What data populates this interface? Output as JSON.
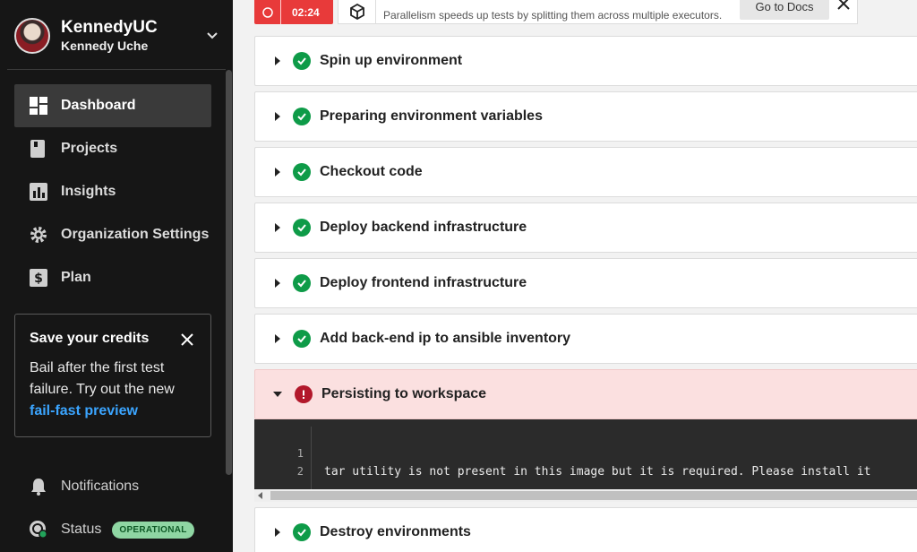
{
  "org": {
    "name": "KennedyUC",
    "user": "Kennedy Uche"
  },
  "nav": {
    "items": [
      {
        "label": "Dashboard",
        "icon": "dashboard-icon",
        "active": true
      },
      {
        "label": "Projects",
        "icon": "projects-icon",
        "active": false
      },
      {
        "label": "Insights",
        "icon": "insights-icon",
        "active": false
      },
      {
        "label": "Organization Settings",
        "icon": "gear-icon",
        "active": false
      },
      {
        "label": "Plan",
        "icon": "dollar-icon",
        "active": false
      }
    ]
  },
  "credits": {
    "title": "Save your credits",
    "body": "Bail after the first test failure. Try out the new",
    "link": "fail-fast preview"
  },
  "bottom": {
    "notifications": "Notifications",
    "status": "Status",
    "status_badge": "OPERATIONAL"
  },
  "job": {
    "timer": "02:24"
  },
  "tip": {
    "text": "Parallelism speeds up tests by splitting them across multiple executors.",
    "button": "Go to Docs"
  },
  "steps": [
    {
      "label": "Spin up environment",
      "status": "success"
    },
    {
      "label": "Preparing environment variables",
      "status": "success"
    },
    {
      "label": "Checkout code",
      "status": "success"
    },
    {
      "label": "Deploy backend infrastructure",
      "status": "success"
    },
    {
      "label": "Deploy frontend infrastructure",
      "status": "success"
    },
    {
      "label": "Add back-end ip to ansible inventory",
      "status": "success"
    },
    {
      "label": "Persisting to workspace",
      "status": "failed"
    },
    {
      "label": "Destroy environments",
      "status": "success"
    }
  ],
  "terminal": {
    "line_numbers": [
      "1",
      "2"
    ],
    "output": "tar utility is not present in this image but it is required. Please install it"
  },
  "colors": {
    "success": "#0e9b48",
    "failure": "#b2182b",
    "link": "#3ba5ff",
    "timer": "#e83a3a"
  }
}
